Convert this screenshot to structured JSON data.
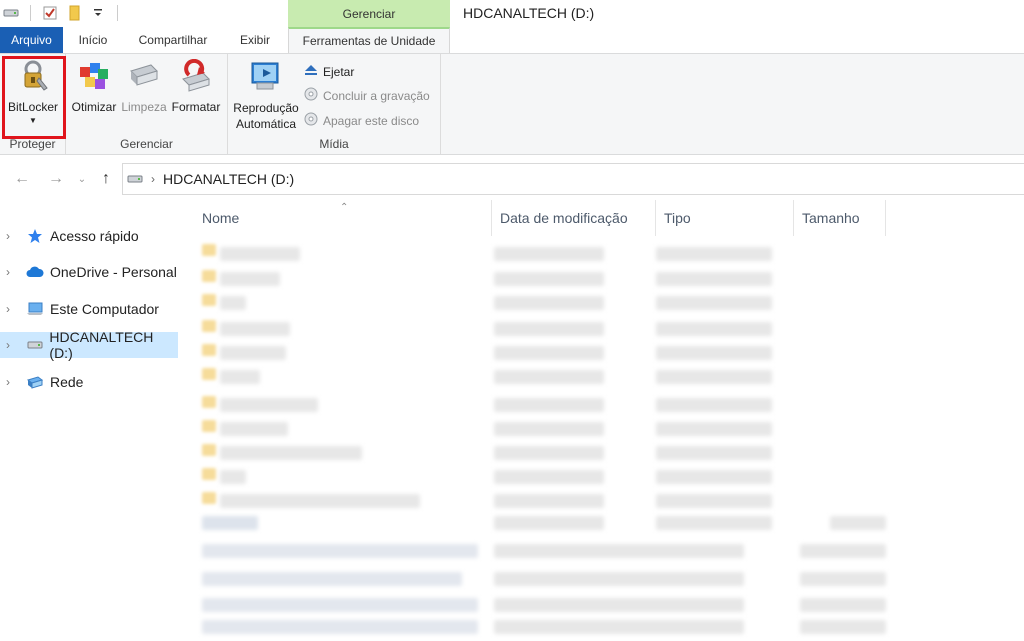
{
  "window": {
    "title": "HDCANALTECH (D:)",
    "context_group": "Gerenciar"
  },
  "tabs": {
    "file": "Arquivo",
    "home": "Início",
    "share": "Compartilhar",
    "view": "Exibir",
    "drive_tools": "Ferramentas de Unidade"
  },
  "ribbon": {
    "protect": {
      "label": "Proteger",
      "bitlocker": "BitLocker"
    },
    "manage": {
      "label": "Gerenciar",
      "optimize": "Otimizar",
      "cleanup": "Limpeza",
      "format": "Formatar"
    },
    "media": {
      "label": "Mídia",
      "autoplay_line1": "Reprodução",
      "autoplay_line2": "Automática",
      "eject": "Ejetar",
      "finish_burning": "Concluir a gravação",
      "erase_disc": "Apagar este disco"
    },
    "highlight_color": "#e0141c"
  },
  "address": {
    "path": "HDCANALTECH (D:)"
  },
  "navpane": {
    "items": [
      {
        "label": "Acesso rápido",
        "icon": "star-icon"
      },
      {
        "label": "OneDrive - Personal",
        "icon": "cloud-icon"
      },
      {
        "label": "Este Computador",
        "icon": "computer-icon"
      },
      {
        "label": "HDCANALTECH (D:)",
        "icon": "drive-icon",
        "selected": true
      },
      {
        "label": "Rede",
        "icon": "network-icon"
      }
    ]
  },
  "filelist": {
    "columns": [
      "Nome",
      "Data de modificação",
      "Tipo",
      "Tamanho"
    ]
  }
}
